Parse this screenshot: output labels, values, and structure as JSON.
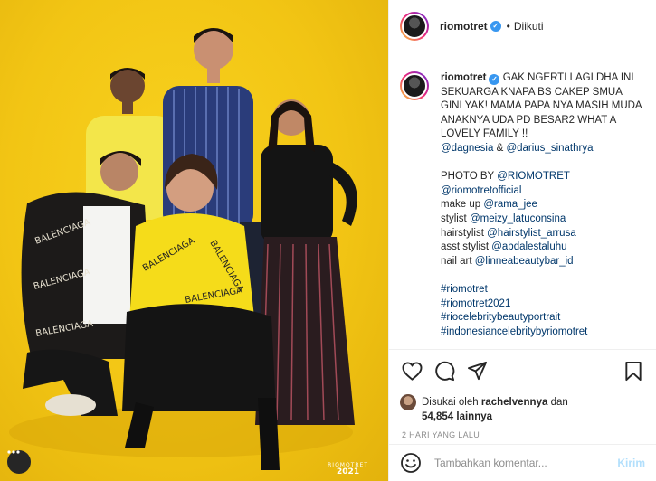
{
  "colors": {
    "photo_bg": "#f2c514",
    "link": "#00376b",
    "verified": "#3897f0",
    "post_button": "#b2dffc",
    "muted": "#8e8e8e"
  },
  "header": {
    "username": "riomotret",
    "separator": "•",
    "follow_status": "Diikuti",
    "verified_icon": "verified-badge"
  },
  "caption": {
    "username": "riomotret",
    "text": "GAK NGERTI LAGI DHA INI SEKUARGA KNAPA BS CAKEP SMUA GINI YAK! MAMA PAPA NYA MASIH MUDA ANAKNYA UDA PD BESAR2 WHAT A LOVELY FAMILY !!",
    "mention1": "@dagnesia",
    "amp": "&",
    "mention2": "@darius_sinathrya",
    "credits": [
      {
        "label": "PHOTO BY ",
        "value": "@RIOMOTRET"
      },
      {
        "label": "",
        "value": "@riomotretofficial"
      },
      {
        "label": "make up ",
        "value": "@rama_jee"
      },
      {
        "label": "stylist ",
        "value": "@meizy_latuconsina"
      },
      {
        "label": "hairstylist ",
        "value": "@hairstylist_arrusa"
      },
      {
        "label": "asst stylist ",
        "value": "@abdalestaluhu"
      },
      {
        "label": "nail art ",
        "value": "@linneabeautybar_id"
      }
    ],
    "hashtags": [
      "#riomotret",
      "#riomotret2021",
      "#riocelebritybeautyportrait",
      "#indonesiancelebritybyriomotret"
    ]
  },
  "actions": {
    "like_icon": "heart-icon",
    "comment_icon": "comment-icon",
    "share_icon": "paper-plane-icon",
    "save_icon": "bookmark-icon"
  },
  "likes": {
    "prefix": "Disukai oleh",
    "user": "rachelvennya",
    "conj": "dan",
    "count": "54,854",
    "suffix": "lainnya"
  },
  "timestamp": "2 HARI YANG LALU",
  "comment_box": {
    "placeholder": "Tambahkan komentar...",
    "post_label": "Kirim",
    "emoji_icon": "smiley-icon"
  },
  "photo": {
    "watermark_brand": "RIOMOTRET",
    "watermark_year": "2021"
  }
}
